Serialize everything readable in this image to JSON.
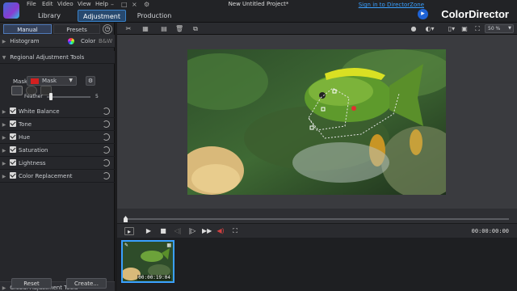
{
  "app": {
    "menus": [
      "File",
      "Edit",
      "Video",
      "View",
      "Help"
    ],
    "title": "New Untitled Project*",
    "signin": "Sign in to DirectorZone",
    "brand": "ColorDirector",
    "modes": [
      "Library",
      "Adjustment",
      "Production"
    ],
    "active_mode": "Adjustment"
  },
  "panel": {
    "subtabs": [
      "Manual",
      "Presets"
    ],
    "active_subtab": "Manual",
    "histogram": "Histogram",
    "color_label": "Color",
    "bw_label": "B&W",
    "regional_title": "Regional Adjustment Tools",
    "mask_label": "Mask",
    "mask_value": "Mask",
    "feather_label": "Feather",
    "feather_value": "5",
    "feather_fraction": 0.05,
    "adjustments": [
      "White Balance",
      "Tone",
      "Hue",
      "Saturation",
      "Lightness",
      "Color Replacement"
    ],
    "global_title": "Global Adjustment Tools",
    "reset_label": "Reset",
    "create_label": "Create..."
  },
  "toolbar": {
    "zoom": "50 %"
  },
  "playback": {
    "timecode": "00:00:00:00",
    "position_fraction": 0.0
  },
  "tray": {
    "thumb_time": "00:00:19:04"
  },
  "colors": {
    "accent": "#3aa0ff",
    "mask_swatch": "#d32020"
  }
}
